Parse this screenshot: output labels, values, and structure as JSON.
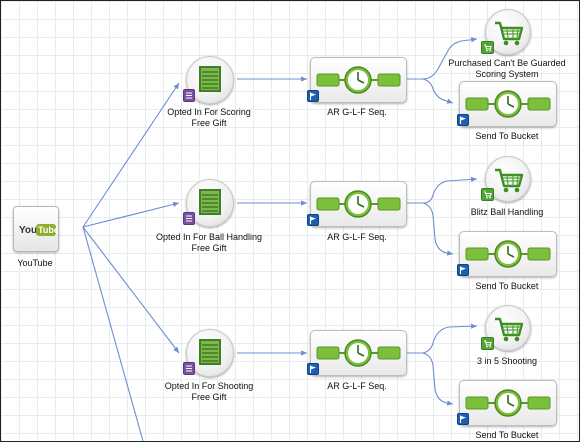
{
  "colors": {
    "wire": "#6d8fcf",
    "seq_green": "#7cbf3a",
    "flag_blue": "#1d5fb0",
    "form_purple": "#7b4fa3",
    "cart_green": "#52a534"
  },
  "source": {
    "label": "YouTube",
    "logo_you": "You",
    "logo_tube": "Tube",
    "icon": "youtube-logo"
  },
  "forms": [
    {
      "label_line1": "Opted In For Scoring",
      "label_line2": "Free Gift",
      "icon": "form-icon",
      "badge": "note-icon"
    },
    {
      "label_line1": "Opted In For Ball Handling",
      "label_line2": "Free Gift",
      "icon": "form-icon",
      "badge": "note-icon"
    },
    {
      "label_line1": "Opted In For Shooting",
      "label_line2": "Free Gift",
      "icon": "form-icon",
      "badge": "note-icon"
    }
  ],
  "sequences": [
    {
      "label": "AR G-L-F Seq.",
      "icon": "timer-sequence-icon",
      "badge": "flag-icon"
    },
    {
      "label": "AR G-L-F Seq.",
      "icon": "timer-sequence-icon",
      "badge": "flag-icon"
    },
    {
      "label": "AR G-L-F Seq.",
      "icon": "timer-sequence-icon",
      "badge": "flag-icon"
    }
  ],
  "purchases": [
    {
      "label_line1": "Purchased Can't Be Guarded",
      "label_line2": "Scoring System",
      "icon": "shopping-cart-icon",
      "badge": "cart-badge-icon"
    },
    {
      "label_line1": "Blitz Ball Handling",
      "label_line2": "",
      "icon": "shopping-cart-icon",
      "badge": "cart-badge-icon"
    },
    {
      "label_line1": "3 in 5 Shooting",
      "label_line2": "",
      "icon": "shopping-cart-icon",
      "badge": "cart-badge-icon"
    }
  ],
  "buckets": [
    {
      "label": "Send To Bucket",
      "icon": "timer-sequence-icon",
      "badge": "flag-icon"
    },
    {
      "label": "Send To Bucket",
      "icon": "timer-sequence-icon",
      "badge": "flag-icon"
    },
    {
      "label": "Send To Bucket",
      "icon": "timer-sequence-icon",
      "badge": "flag-icon"
    }
  ]
}
